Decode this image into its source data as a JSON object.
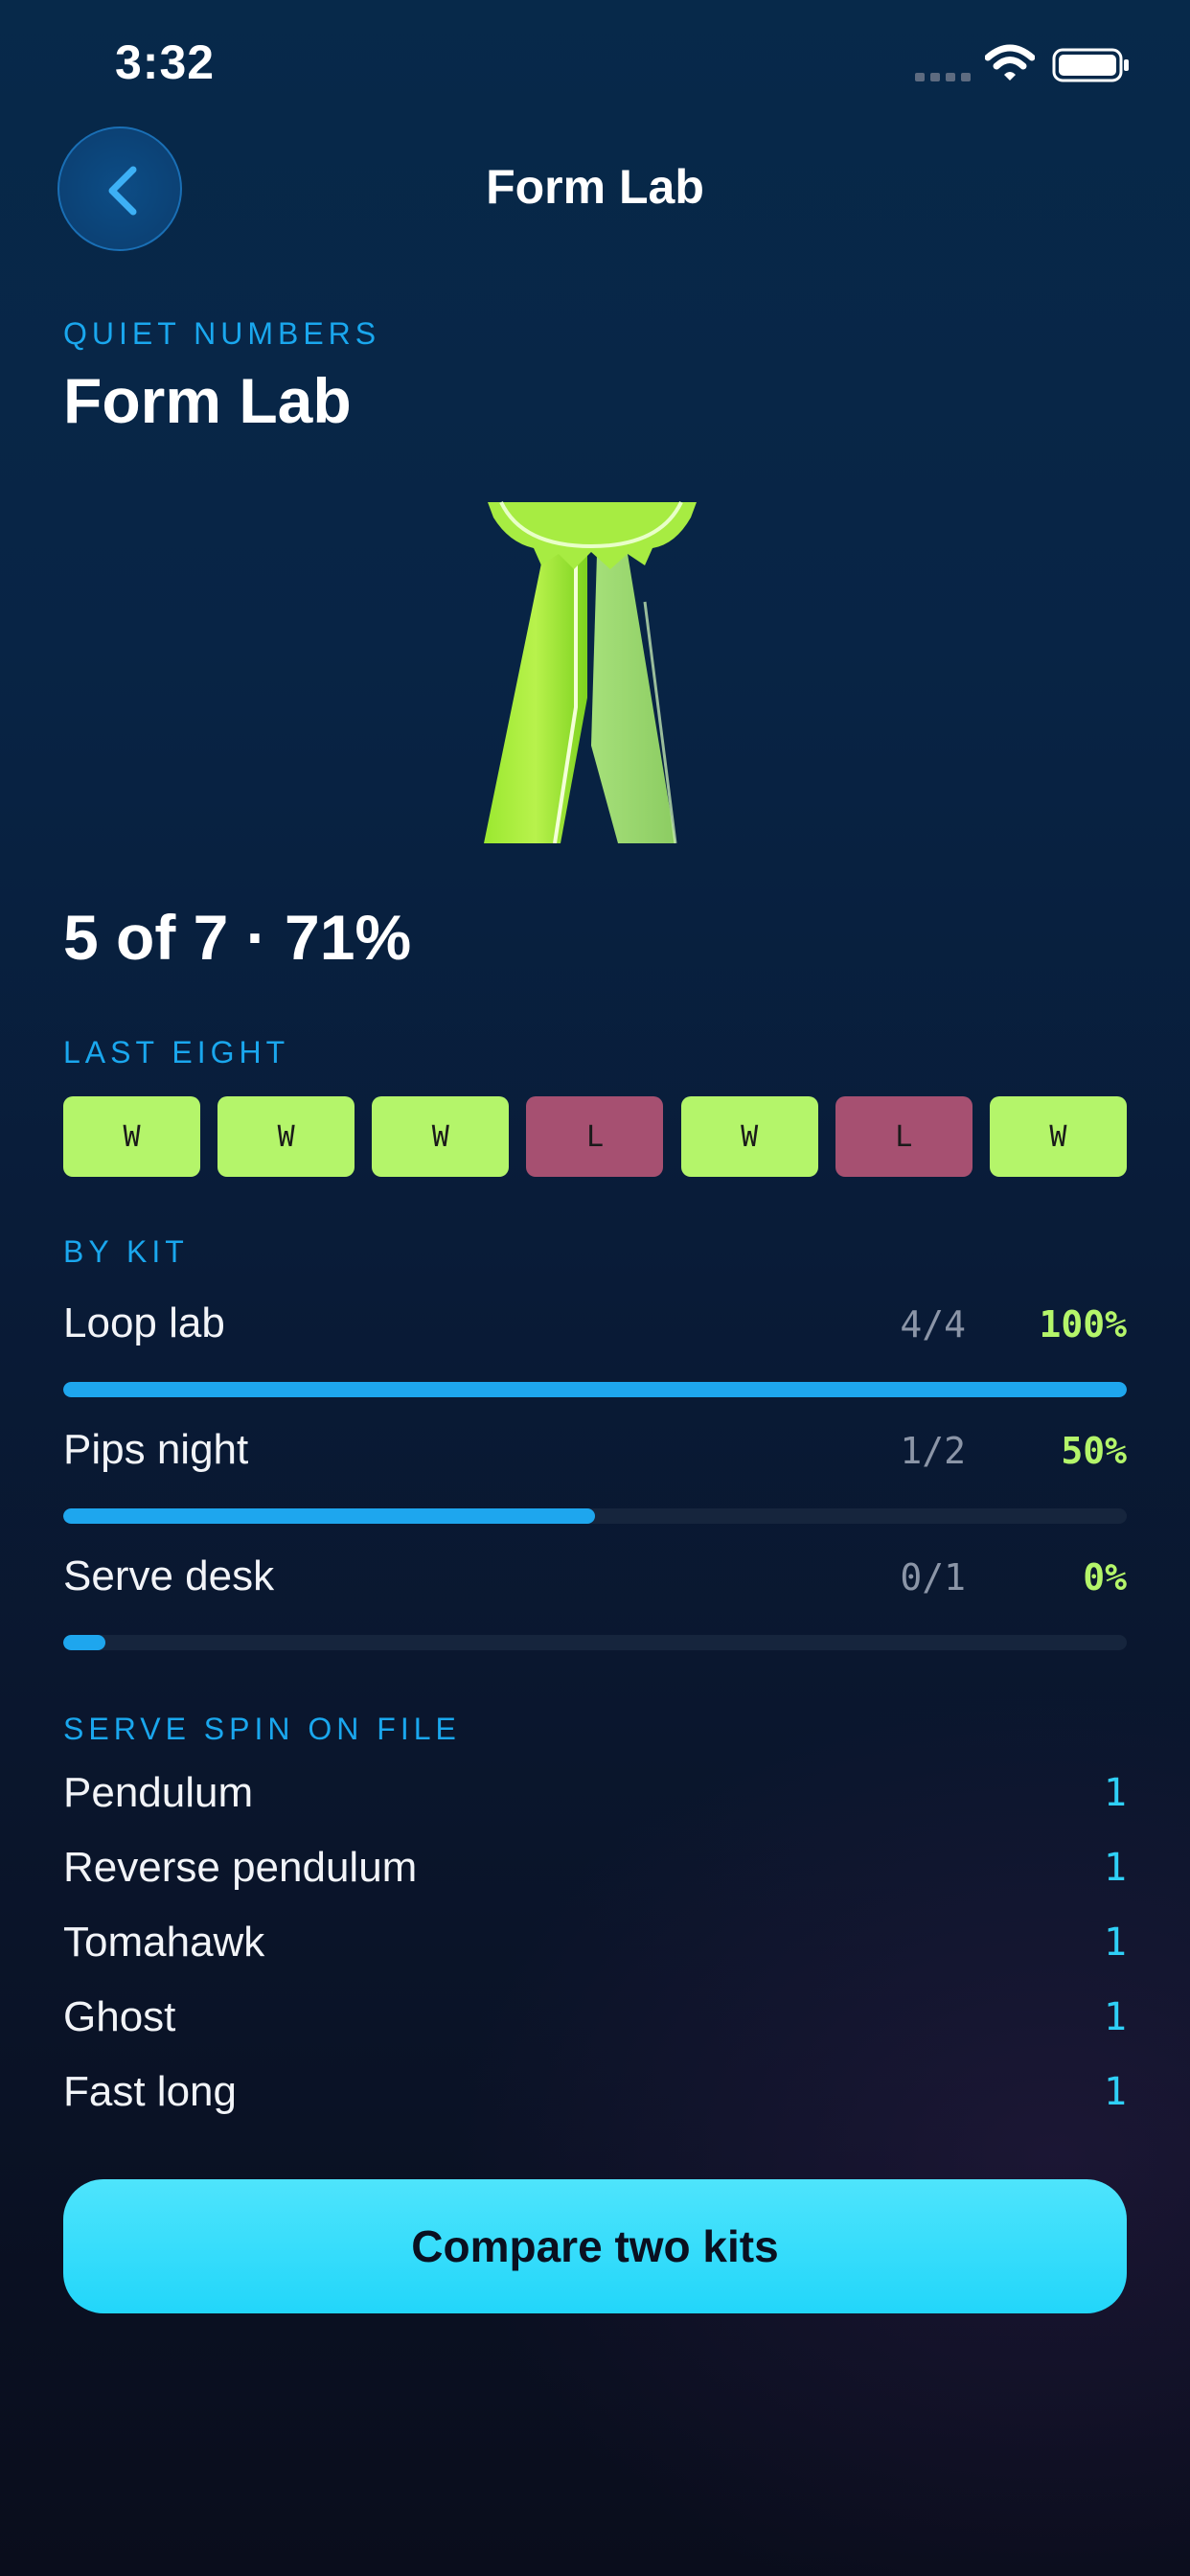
{
  "status_bar": {
    "time": "3:32"
  },
  "nav": {
    "back_icon": "chevron-left-icon",
    "title": "Form Lab"
  },
  "header": {
    "eyebrow": "QUIET NUMBERS",
    "title": "Form Lab",
    "art_icon": "award-ribbon-icon"
  },
  "summary": {
    "text": "5 of 7 · 71%",
    "wins": 5,
    "played": 7,
    "percent": 71
  },
  "last_eight": {
    "label": "LAST EIGHT",
    "results": [
      {
        "result": "W"
      },
      {
        "result": "W"
      },
      {
        "result": "W"
      },
      {
        "result": "L"
      },
      {
        "result": "W"
      },
      {
        "result": "L"
      },
      {
        "result": "W"
      }
    ]
  },
  "by_kit": {
    "label": "BY KIT",
    "kits": [
      {
        "name": "Loop lab",
        "count": "4/4",
        "percent_label": "100%",
        "fraction": 1.0
      },
      {
        "name": "Pips night",
        "count": "1/2",
        "percent_label": "50%",
        "fraction": 0.5
      },
      {
        "name": "Serve desk",
        "count": "0/1",
        "percent_label": "0%",
        "fraction": 0.0
      }
    ]
  },
  "serve_spin": {
    "label": "SERVE SPIN ON FILE",
    "items": [
      {
        "name": "Pendulum",
        "count": "1"
      },
      {
        "name": "Reverse pendulum",
        "count": "1"
      },
      {
        "name": "Tomahawk",
        "count": "1"
      },
      {
        "name": "Ghost",
        "count": "1"
      },
      {
        "name": "Fast long",
        "count": "1"
      }
    ]
  },
  "actions": {
    "compare_label": "Compare two kits"
  },
  "colors": {
    "accent_blue": "#1ea6ee",
    "win_green": "#b4f56a",
    "loss_red": "#a65071",
    "button_cyan": "#22d6fa"
  }
}
